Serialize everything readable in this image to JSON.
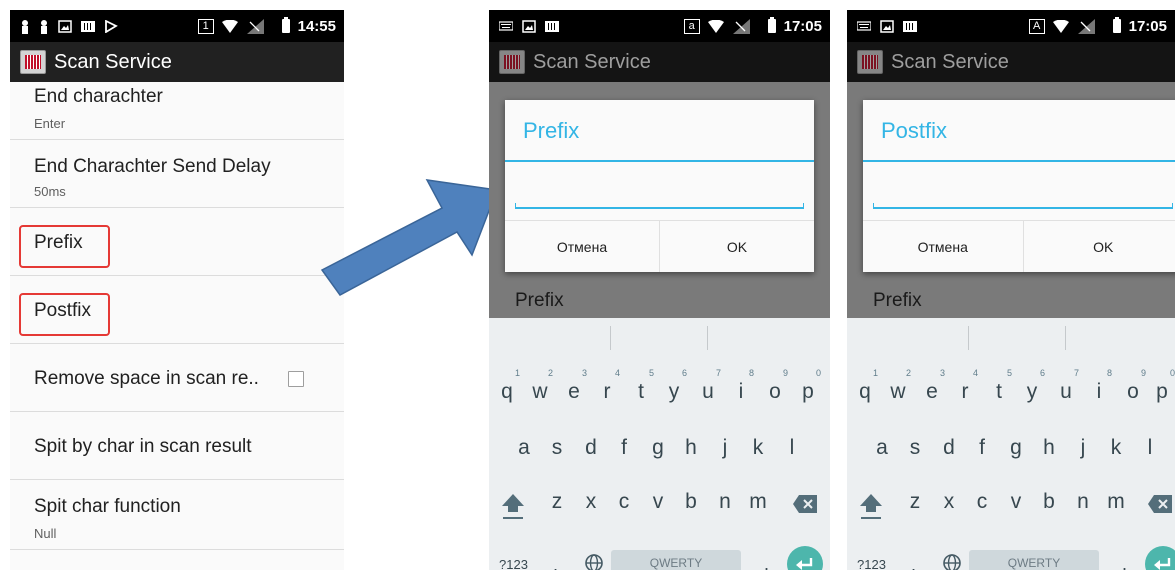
{
  "phone1": {
    "status_time": "14:55",
    "status_box": "1",
    "app_title": "Scan Service",
    "items": [
      {
        "title": "End charachter",
        "subtitle": "Enter"
      },
      {
        "title": "End Charachter Send Delay",
        "subtitle": "50ms"
      },
      {
        "title": "Prefix",
        "subtitle": ""
      },
      {
        "title": "Postfix",
        "subtitle": ""
      },
      {
        "title": "Remove space in scan re..",
        "subtitle": ""
      },
      {
        "title": "Spit by char in scan result",
        "subtitle": ""
      },
      {
        "title": "Spit char function",
        "subtitle": "Null"
      }
    ],
    "remove_space_checked": false,
    "highlight_color": "#e53935"
  },
  "phone2": {
    "status_time": "17:05",
    "status_box": "a",
    "app_title": "Scan Service",
    "dialog_title": "Prefix",
    "input_value": "",
    "cancel_label": "Отмена",
    "ok_label": "OK",
    "behind_label": "Prefix"
  },
  "phone3": {
    "status_time": "17:05",
    "status_box": "A",
    "app_title": "Scan Service",
    "dialog_title": "Postfix",
    "input_value": "",
    "cancel_label": "Отмена",
    "ok_label": "OK",
    "behind_label": "Prefix"
  },
  "keyboard": {
    "row1": [
      "q",
      "w",
      "e",
      "r",
      "t",
      "y",
      "u",
      "i",
      "o",
      "p"
    ],
    "row1_hints": [
      "1",
      "2",
      "3",
      "4",
      "5",
      "6",
      "7",
      "8",
      "9",
      "0"
    ],
    "row2": [
      "a",
      "s",
      "d",
      "f",
      "g",
      "h",
      "j",
      "k",
      "l"
    ],
    "row3": [
      "z",
      "x",
      "c",
      "v",
      "b",
      "n",
      "m"
    ],
    "symbols_label": "?123",
    "comma": ",",
    "period": ".",
    "space_label": "QWERTY"
  },
  "accent_color": "#33b5e5",
  "arrow_color": "#4f81bd"
}
